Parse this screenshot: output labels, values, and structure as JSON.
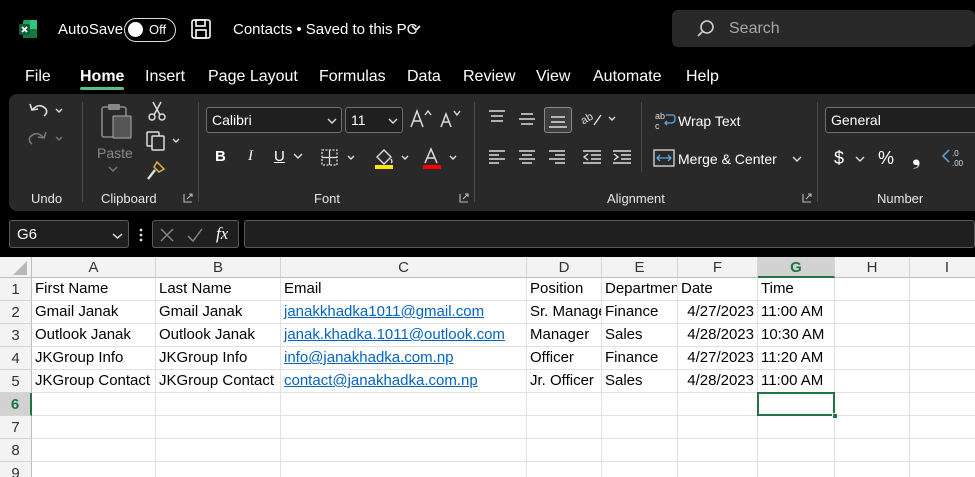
{
  "titlebar": {
    "autosave_label": "AutoSave",
    "autosave_state": "Off",
    "document_title": "Contacts • Saved to this PC",
    "search_placeholder": "Search"
  },
  "tabs": [
    "File",
    "Home",
    "Insert",
    "Page Layout",
    "Formulas",
    "Data",
    "Review",
    "View",
    "Automate",
    "Help"
  ],
  "active_tab": "Home",
  "ribbon": {
    "groups": {
      "undo": "Undo",
      "clipboard": "Clipboard",
      "font": "Font",
      "alignment": "Alignment",
      "number": "Number"
    },
    "paste_label": "Paste",
    "font_name": "Calibri",
    "font_size": "11",
    "wrap_text": "Wrap Text",
    "merge_center": "Merge & Center",
    "number_format": "General",
    "bold": "B",
    "italic": "I",
    "underline": "U",
    "currency": "$",
    "percent": "%",
    "comma": "❟"
  },
  "formula_bar": {
    "name_box": "G6",
    "fx": "fx",
    "formula": ""
  },
  "sheet": {
    "columns": [
      "A",
      "B",
      "C",
      "D",
      "E",
      "F",
      "G",
      "H",
      "I"
    ],
    "rows": [
      "1",
      "2",
      "3",
      "4",
      "5",
      "6",
      "7",
      "8",
      "9"
    ],
    "selected_column": "G",
    "selected_row": "6",
    "data": [
      [
        "First Name",
        "Last Name",
        "Email",
        "Position",
        "Department",
        "Date",
        "Time"
      ],
      [
        "Gmail Janak",
        "Gmail Janak",
        "janakkhadka1011@gmail.com",
        "Sr. Manager",
        "Finance",
        "4/27/2023",
        "11:00 AM"
      ],
      [
        "Outlook Janak",
        "Outlook Janak",
        "janak.khadka.1011@outlook.com",
        "Manager",
        "Sales",
        "4/28/2023",
        "10:30 AM"
      ],
      [
        "JKGroup Info",
        "JKGroup Info",
        "info@janakhadka.com.np",
        "Officer",
        "Finance",
        "4/27/2023",
        "11:20 AM"
      ],
      [
        "JKGroup Contact",
        "JKGroup Contact",
        "contact@janakhadka.com.np",
        "Jr. Officer",
        "Sales",
        "4/28/2023",
        "11:00 AM"
      ]
    ]
  },
  "colors": {
    "accent": "#217346",
    "tab_underline": "#5bbf85",
    "link": "#0563c1",
    "ribbon_bg": "#292929"
  }
}
